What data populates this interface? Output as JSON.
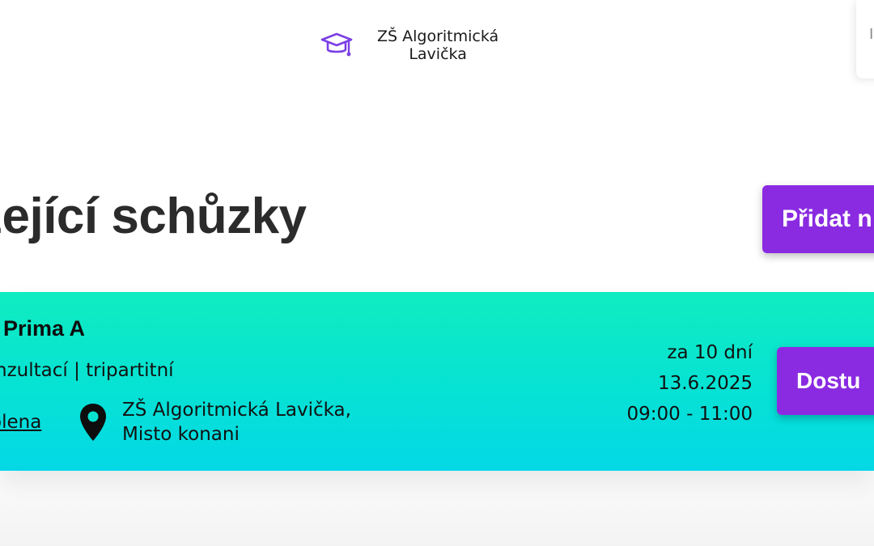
{
  "brand": {
    "name_line1": "ZŠ Algoritmická",
    "name_line2": "Lavička",
    "icon": "graduation-cap-icon"
  },
  "corner_card": {
    "text": "I"
  },
  "page": {
    "title": "zející schůzky",
    "add_button_label": "Přidat n"
  },
  "meeting": {
    "class_name": "Prima A",
    "type": "nzultací | tripartitní",
    "status": "olena",
    "location_line1": "ZŠ Algoritmická Lavička,",
    "location_line2": "Misto konani",
    "relative_time": "za 10 dní",
    "date": "13.6.2025",
    "time_range": "09:00 - 11:00",
    "action_label": "Dostu",
    "location_icon": "map-pin-icon"
  },
  "colors": {
    "accent": "#8a2be2",
    "brand_icon": "#7b3fe4",
    "card_gradient_top": "#10ecc0",
    "card_gradient_bottom": "#04d8e6"
  }
}
